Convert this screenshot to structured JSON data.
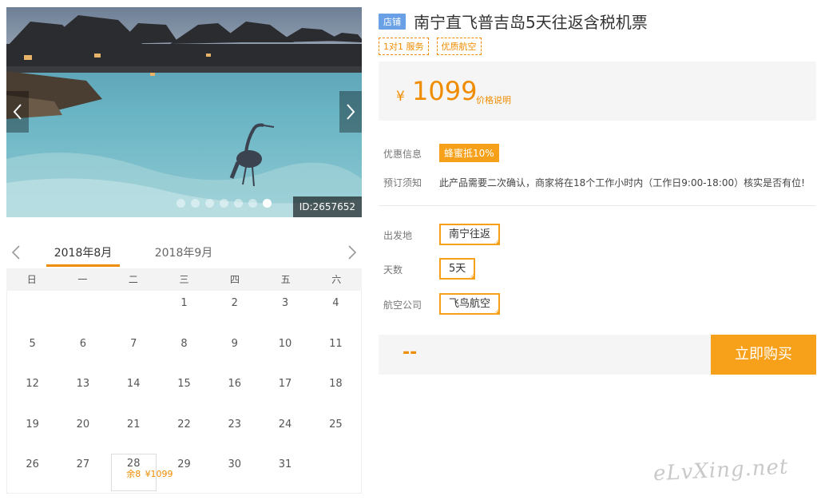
{
  "gallery": {
    "image_id": "ID:2657652",
    "dot_count": 7,
    "active_dot": 6
  },
  "calendar": {
    "months": [
      "2018年8月",
      "2018年9月"
    ],
    "active_month": 0,
    "weekdays": [
      "日",
      "一",
      "二",
      "三",
      "四",
      "五",
      "六"
    ],
    "leading_blanks": 3,
    "days": 31,
    "available": {
      "day": "28",
      "price": "¥1099",
      "stock": "余8"
    }
  },
  "product": {
    "shop_tag": "店铺",
    "title": "南宁直飞普吉岛5天往返含税机票",
    "service_tags": [
      "1对1 服务",
      "优质航空"
    ],
    "currency": "¥",
    "price": "1099",
    "price_note": "价格说明"
  },
  "info": {
    "promo_label": "优惠信息",
    "promo_tag": "蜂蜜抵10%",
    "notice_label": "预订须知",
    "notice_text": "此产品需要二次确认，商家将在18个工作小时内（工作日9:00-18:00）核实是否有位!"
  },
  "options": {
    "departure_label": "出发地",
    "departure_value": "南宁往返",
    "days_label": "天数",
    "days_value": "5天",
    "airline_label": "航空公司",
    "airline_value": "飞鸟航空"
  },
  "buy": {
    "total": "--",
    "button": "立即购买"
  },
  "watermark": "eLvXing.net",
  "colors": {
    "accent": "#f7a11a",
    "price": "#f08c00",
    "shop_tag": "#6aa1e6"
  }
}
